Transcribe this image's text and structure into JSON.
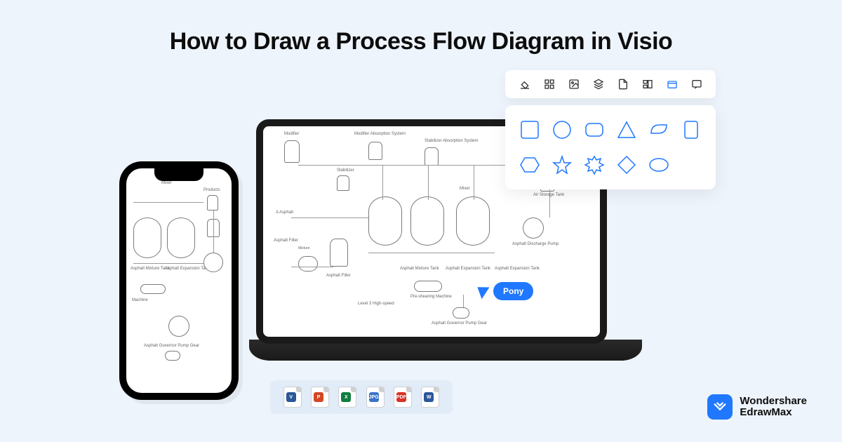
{
  "title": "How to Draw a Process Flow Diagram in Visio",
  "cursor": {
    "label": "Pony"
  },
  "toolbar": {
    "icons": [
      "fill-icon",
      "grid-icon",
      "image-icon",
      "layers-icon",
      "page-icon",
      "align-icon",
      "container-icon",
      "comment-icon"
    ],
    "active_index": 6
  },
  "shape_palette": {
    "row1": [
      "square",
      "circle",
      "rounded-rect",
      "triangle",
      "leaf",
      "rect-vertical"
    ],
    "row2": [
      "hexagon",
      "star",
      "burst",
      "diamond",
      "ellipse",
      "blank"
    ]
  },
  "export_formats": [
    {
      "label": "V",
      "color": "#2b5797"
    },
    {
      "label": "P",
      "color": "#d24726"
    },
    {
      "label": "X",
      "color": "#107c41"
    },
    {
      "label": "JPG",
      "color": "#3a73c9"
    },
    {
      "label": "PDF",
      "color": "#d93025"
    },
    {
      "label": "W",
      "color": "#2b579a"
    }
  ],
  "brand": {
    "line1": "Wondershare",
    "line2": "EdrawMax"
  },
  "flow_labels": {
    "modifier": "Modifier",
    "absorption": "Modifier Absorption System",
    "stabilizer": "Stabilizer Absorption System",
    "products": "Products",
    "stabilizer2": "Stabilizer",
    "asphalt_a": "A Asphalt",
    "mixer": "Mixer",
    "air_tank": "Air Storage Tank",
    "asphalt_filter": "Asphalt Filter",
    "asphalt_filler": "Asphalt Filler",
    "mixture_tank": "Asphalt Mixture Tank",
    "expansion_tank": "Asphalt Expansion Tank",
    "expansion_tank2": "Asphalt Expansion Tank",
    "preshearing": "Pre-shearing Machine",
    "discharge_pump": "Asphalt Discharge Pump",
    "governor": "Asphalt Governor Pump Gear",
    "level_gauge": "Level 3 High-speed",
    "machine": "Machine"
  }
}
